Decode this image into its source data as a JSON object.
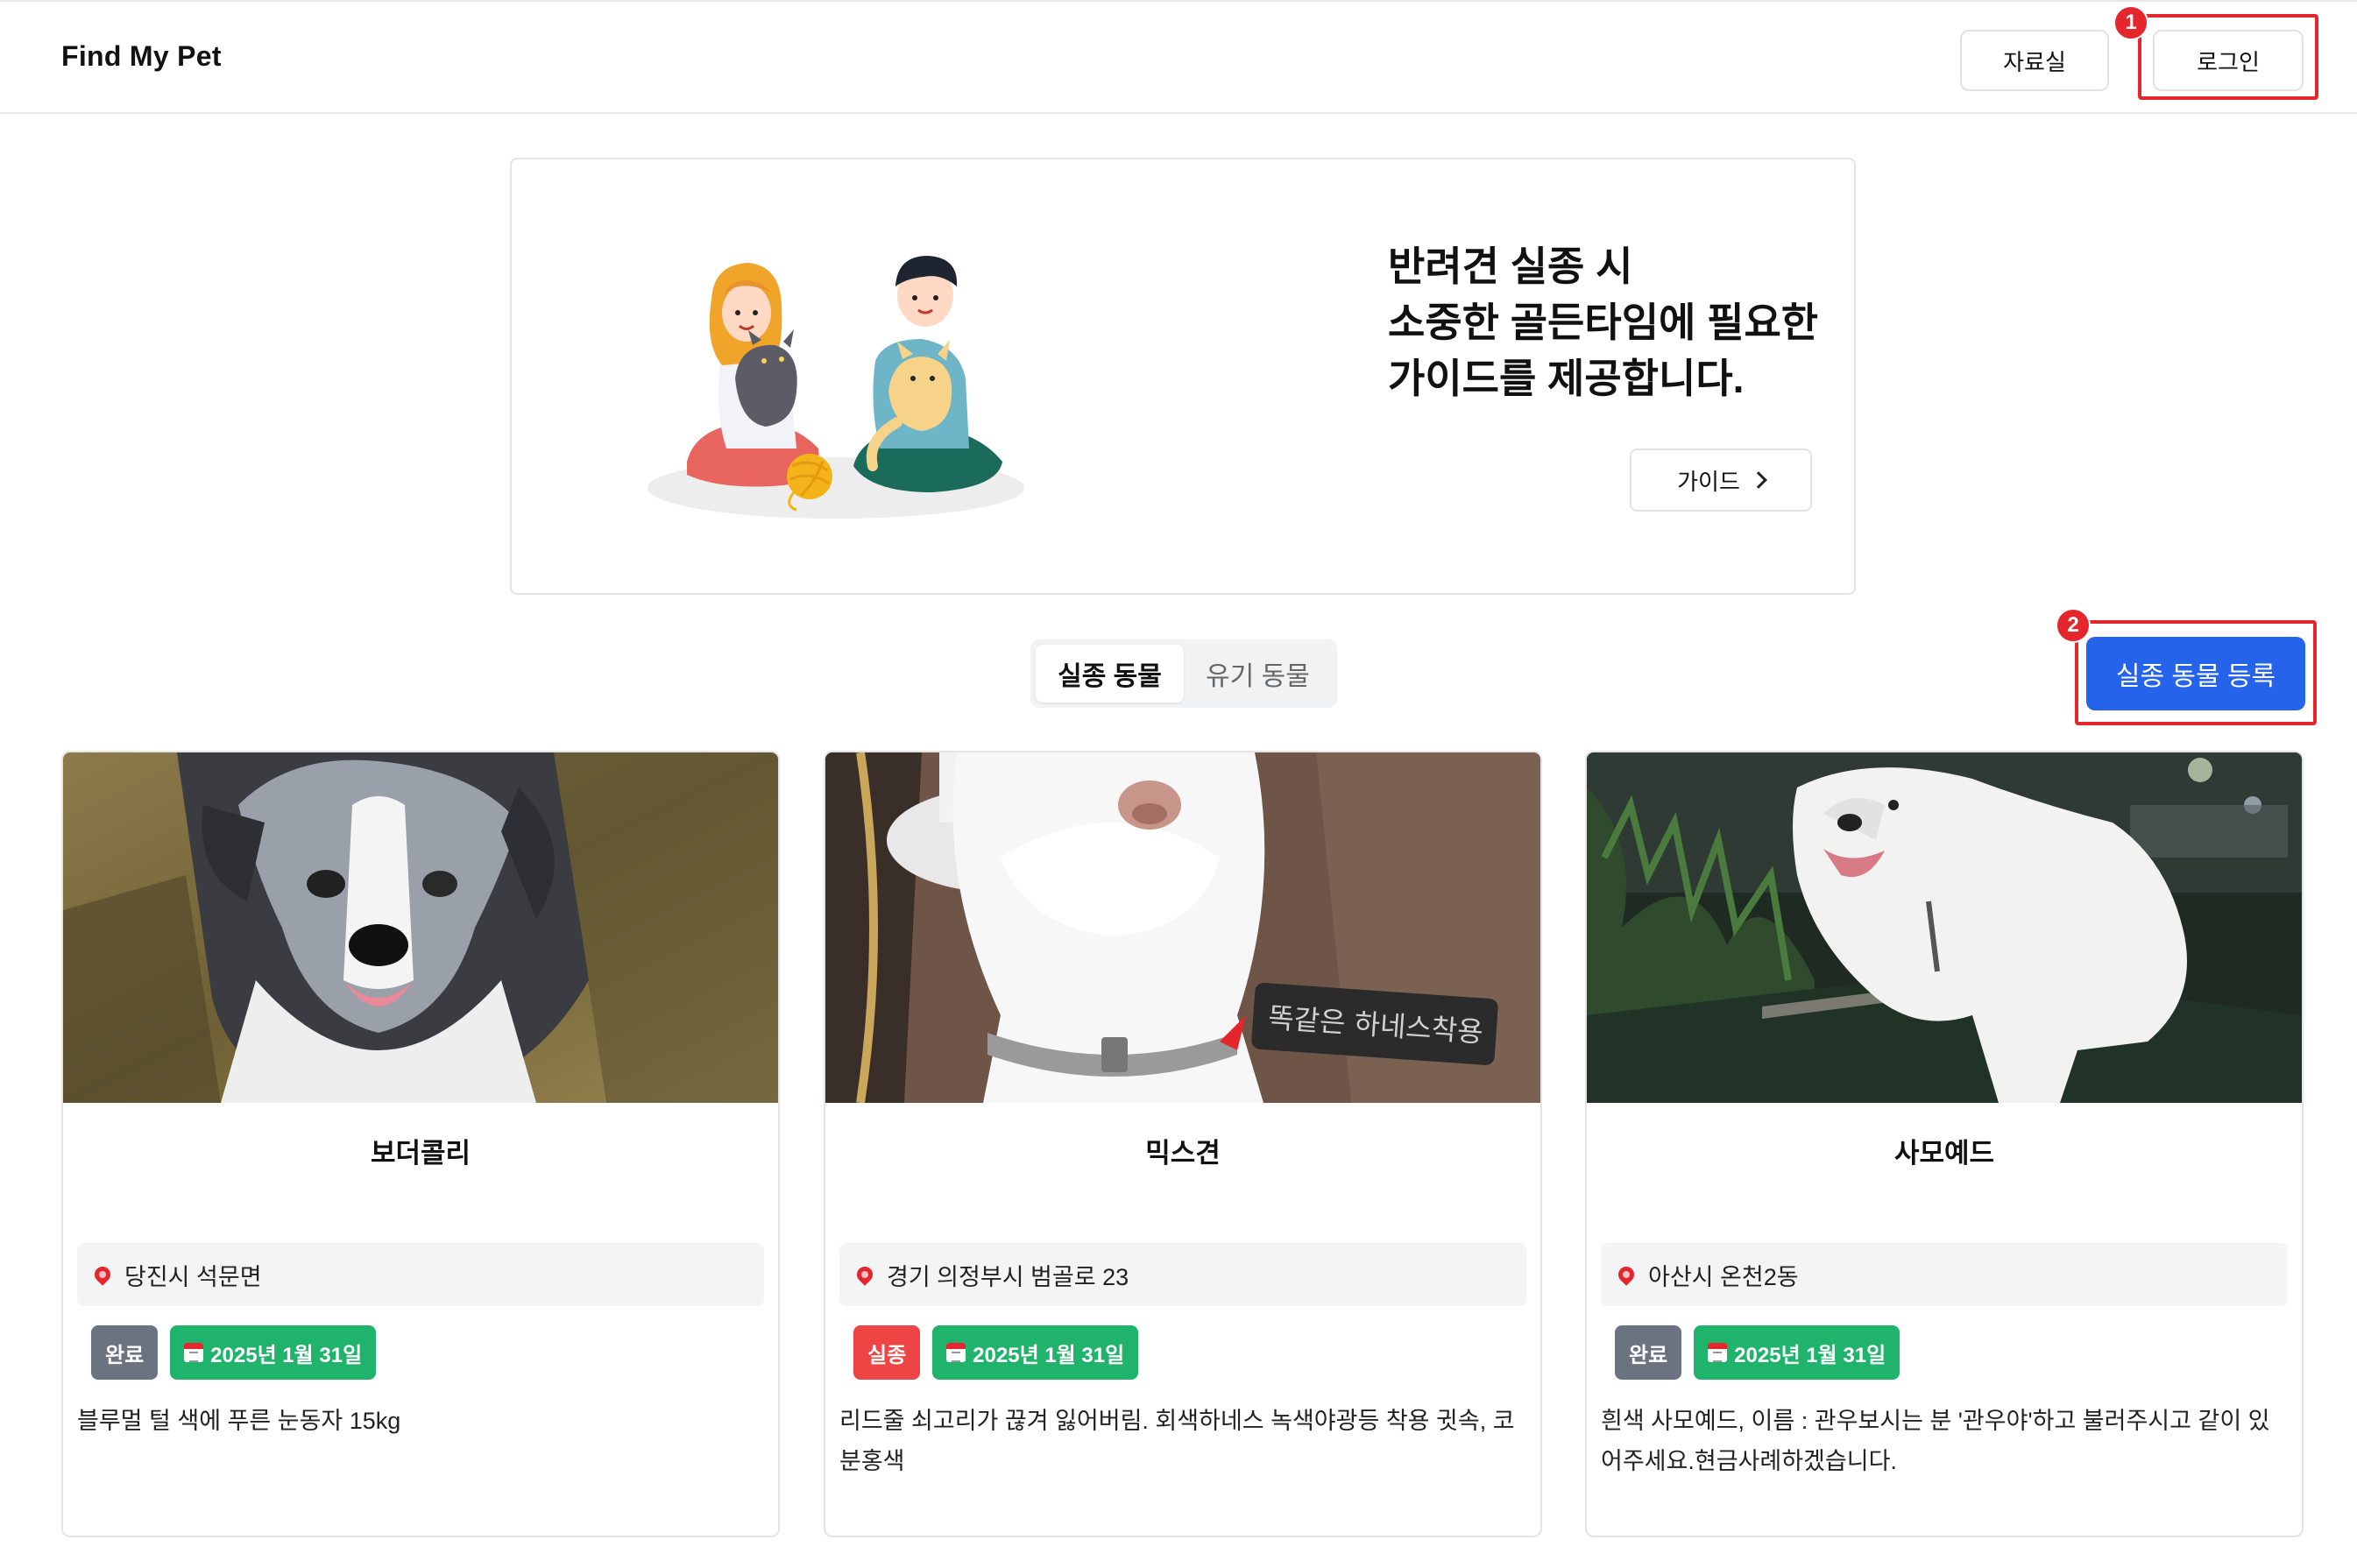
{
  "header": {
    "brand": "Find My Pet",
    "archive_label": "자료실",
    "login_label": "로그인"
  },
  "annotations": {
    "one": "1",
    "two": "2"
  },
  "banner": {
    "title_line1": "반려견 실종 시",
    "title_line2": "소중한 골든타임에 필요한",
    "title_line3": "가이드를 제공합니다.",
    "guide_label": "가이드"
  },
  "tabs": {
    "lost": "실종 동물",
    "abandoned": "유기 동물",
    "active": "lost"
  },
  "register_label": "실종 동물 등록",
  "cards": [
    {
      "name": "보더콜리",
      "location": "당진시 석문면",
      "status": "완료",
      "date": "2025년 1월 31일",
      "description": "블루멀 털 색에 푸른 눈동자 15kg"
    },
    {
      "name": "믹스견",
      "location": "경기 의정부시 범골로 23",
      "status": "실종",
      "date": "2025년 1월 31일",
      "description": "리드줄 쇠고리가 끊겨 잃어버림. 회색하네스 녹색야광등 착용 귓속, 코 분홍색",
      "photo_text": "똑같은 하네스착용"
    },
    {
      "name": "사모예드",
      "location": "아산시 온천2동",
      "status": "완료",
      "date": "2025년 1월 31일",
      "description": "흰색 사모예드, 이름 : 관우보시는 분 '관우야'하고 불러주시고 같이 있어주세요.현금사례하겠습니다."
    }
  ],
  "colors": {
    "accent": "#2563eb",
    "annotation": "#e5262c",
    "status_done": "#6b7280",
    "status_lost": "#ef4444",
    "date_badge": "#1fb36b"
  },
  "icons": {
    "location": "pin-icon",
    "date": "calendar-icon",
    "guide_arrow": "chevron-right-icon"
  }
}
